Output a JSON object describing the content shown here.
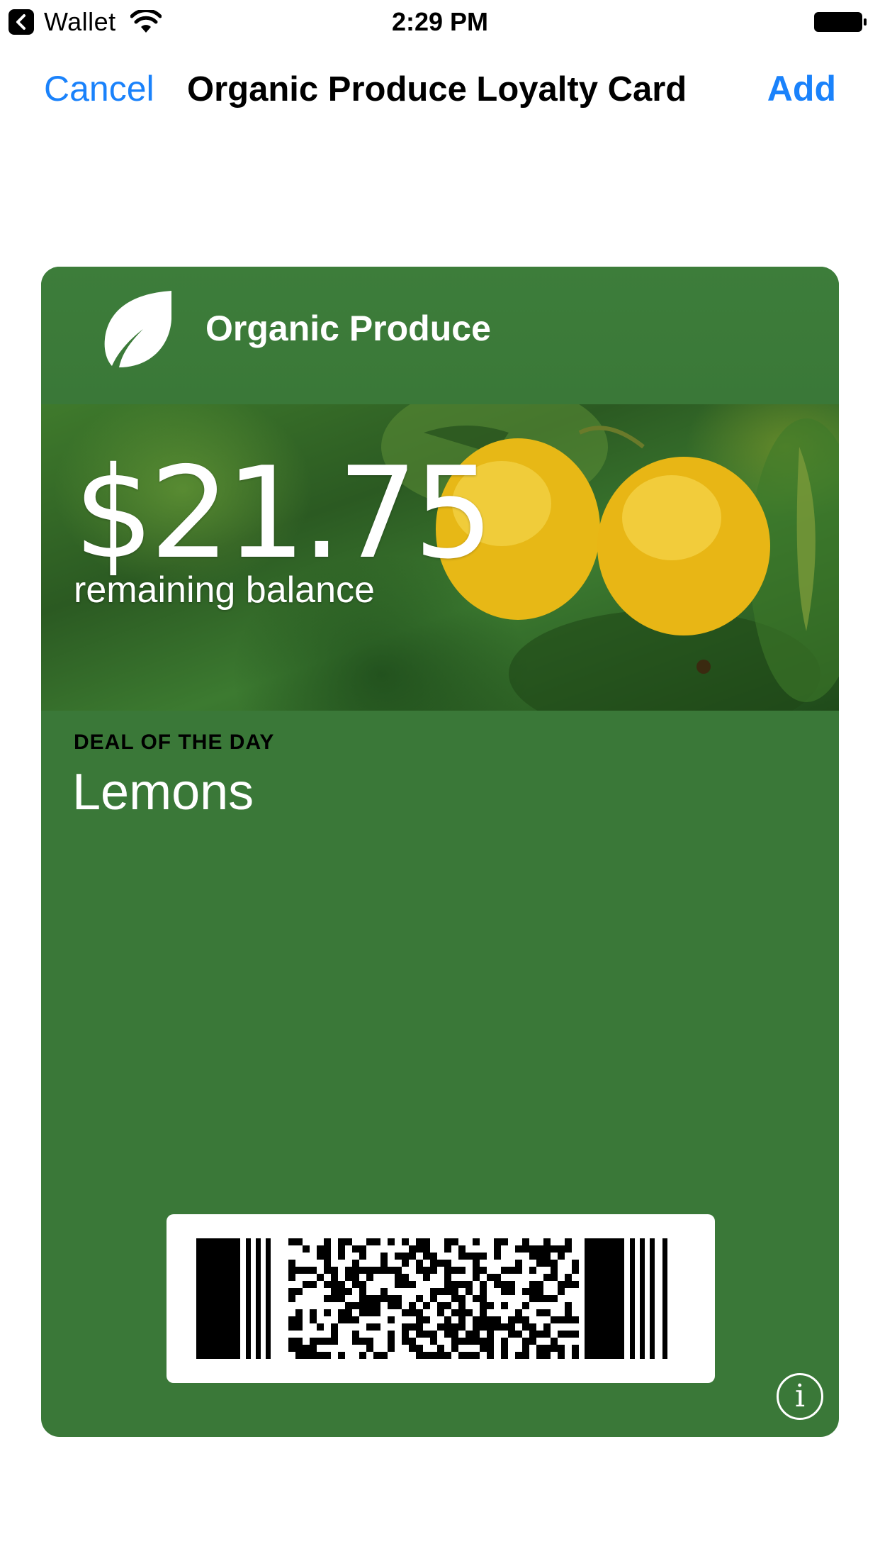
{
  "status_bar": {
    "back_app": "Wallet",
    "time": "2:29 PM",
    "icons": [
      "back-chevron-icon",
      "wifi-icon",
      "battery-icon"
    ]
  },
  "nav": {
    "cancel_label": "Cancel",
    "title": "Organic Produce Loyalty Card",
    "add_label": "Add"
  },
  "pass": {
    "organization": "Organic Produce",
    "logo_icon": "leaf-icon",
    "balance": "$21.75",
    "balance_label": "remaining balance",
    "deal_label": "DEAL OF THE DAY",
    "deal_value": "Lemons",
    "barcode_format": "PDF417",
    "info_icon": "info-icon",
    "colors": {
      "background": "#3a7838",
      "foreground": "#ffffff",
      "label": "#000000"
    }
  },
  "colors": {
    "accent": "#1a82fb"
  }
}
